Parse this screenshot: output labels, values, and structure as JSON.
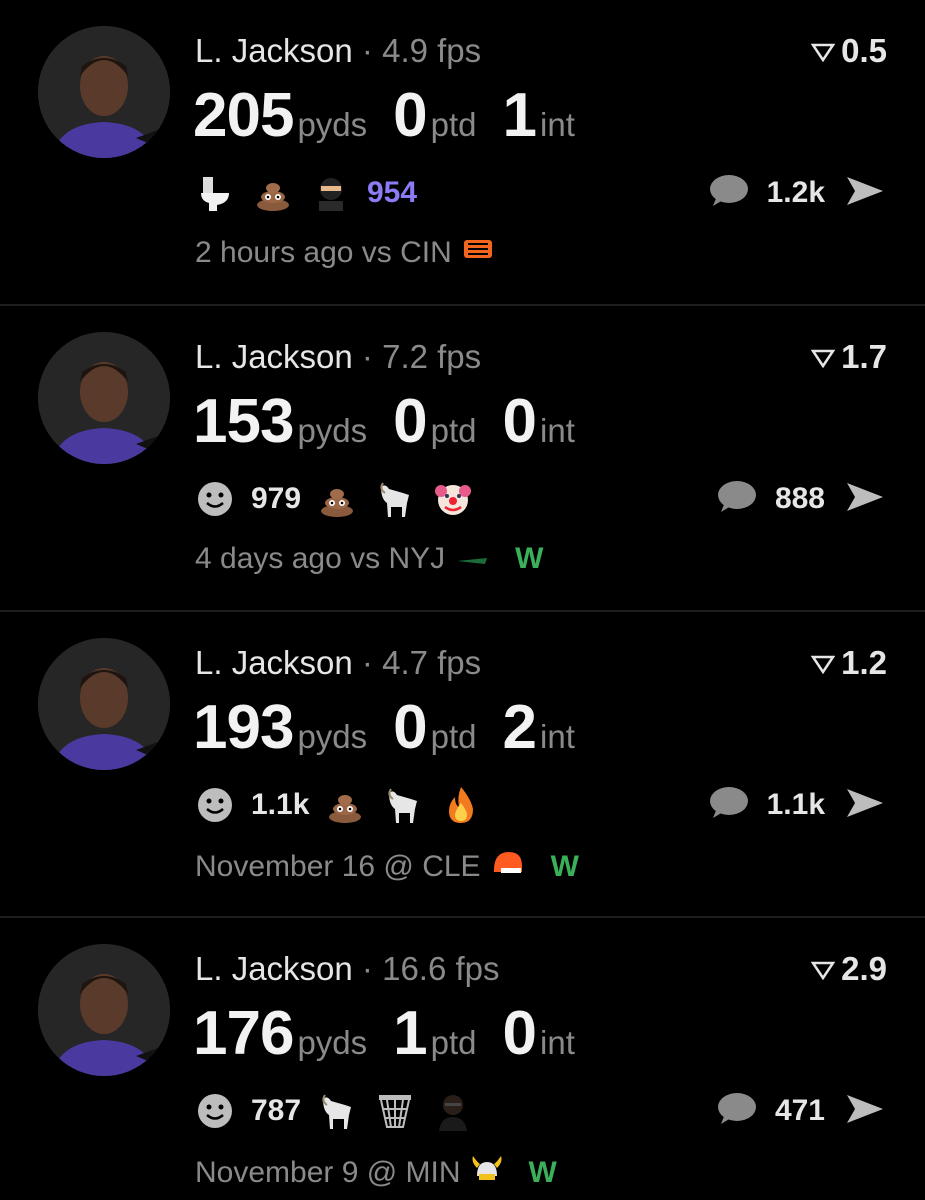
{
  "feed": [
    {
      "player": "L. Jackson",
      "separator": "·",
      "fps": "4.9 fps",
      "projection": "0.5",
      "pyds": "205",
      "pyds_label": "pyds",
      "ptd": "0",
      "ptd_label": "ptd",
      "int": "1",
      "int_label": "int",
      "reactions": [
        "toilet-icon",
        "poop-icon",
        "ninja-icon"
      ],
      "reaction_count": "954",
      "comment_count": "1.2k",
      "game": "2 hours ago vs CIN",
      "team_logo": "bengals-logo",
      "result": ""
    },
    {
      "player": "L. Jackson",
      "separator": "·",
      "fps": "7.2 fps",
      "projection": "1.7",
      "pyds": "153",
      "pyds_label": "pyds",
      "ptd": "0",
      "ptd_label": "ptd",
      "int": "0",
      "int_label": "int",
      "reactions": [
        "smiley-icon",
        "poop-icon",
        "goat-icon",
        "clown-icon"
      ],
      "reaction_count": "979",
      "comment_count": "888",
      "game": "4 days ago vs NYJ",
      "team_logo": "jets-logo",
      "result": "W"
    },
    {
      "player": "L. Jackson",
      "separator": "·",
      "fps": "4.7 fps",
      "projection": "1.2",
      "pyds": "193",
      "pyds_label": "pyds",
      "ptd": "0",
      "ptd_label": "ptd",
      "int": "2",
      "int_label": "int",
      "reactions": [
        "smiley-icon",
        "poop-icon",
        "goat-icon",
        "fire-icon"
      ],
      "reaction_count": "1.1k",
      "comment_count": "1.1k",
      "game": "November 16 @ CLE",
      "team_logo": "browns-logo",
      "result": "W"
    },
    {
      "player": "L. Jackson",
      "separator": "·",
      "fps": "16.6 fps",
      "projection": "2.9",
      "pyds": "176",
      "pyds_label": "pyds",
      "ptd": "1",
      "ptd_label": "ptd",
      "int": "0",
      "int_label": "int",
      "reactions": [
        "smiley-icon",
        "goat-icon",
        "basketball-net-icon",
        "person-icon"
      ],
      "reaction_count": "787",
      "comment_count": "471",
      "game": "November 9 @ MIN",
      "team_logo": "vikings-logo",
      "result": "W"
    }
  ],
  "colors": {
    "background": "#000000",
    "muted": "#8a8a8a",
    "win": "#3bb05a",
    "accent_purple": "#8b7cf6"
  }
}
